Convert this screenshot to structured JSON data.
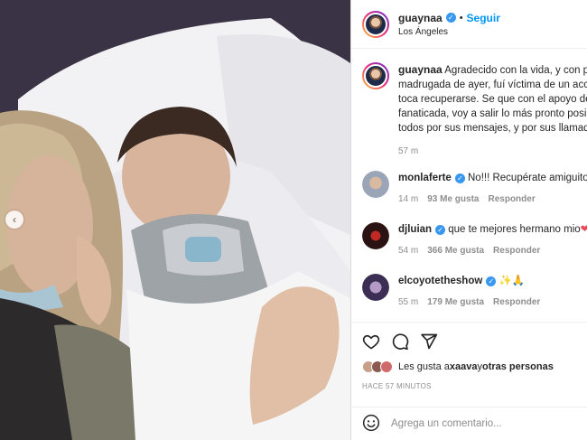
{
  "post": {
    "username": "guaynaa",
    "follow_label": "Seguir",
    "location": "Los Ángeles",
    "caption_lines": [
      "Agradecido con la vida, y con p",
      "madrugada de ayer, fuí víctima de un accic",
      "toca recuperarse. Se que con el apoyo de n",
      "fanaticada, voy a salir lo más pronto posibl",
      "todos por sus mensajes, y por sus llamadas"
    ],
    "caption_time": "57 m"
  },
  "comments": [
    {
      "username": "monlaferte",
      "text": "No!!! Recupérate amiguito! ",
      "time": "14 m",
      "likes": "93 Me gusta",
      "reply": "Responder"
    },
    {
      "username": "djluian",
      "text": "que te mejores hermano mio",
      "emoji": "❤",
      "time": "54 m",
      "likes": "366 Me gusta",
      "reply": "Responder"
    },
    {
      "username": "elcoyotetheshow",
      "text": "✨🙏",
      "time": "55 m",
      "likes": "179 Me gusta",
      "reply": "Responder"
    }
  ],
  "likes": {
    "prefix": "Les gusta a ",
    "user": "xaava",
    "connector": " y ",
    "others": "otras personas"
  },
  "time_ago": "HACE 57 MINUTOS",
  "comment_input": {
    "placeholder": "Agrega un comentario..."
  },
  "colors": {
    "accent": "#0095f6",
    "verified": "#3897f0",
    "muted": "#8e8e8e",
    "heart": "#ed4956"
  },
  "icons": [
    "heart-icon",
    "comment-icon",
    "share-icon",
    "emoji-icon",
    "chevron-left-icon",
    "verified-icon"
  ]
}
